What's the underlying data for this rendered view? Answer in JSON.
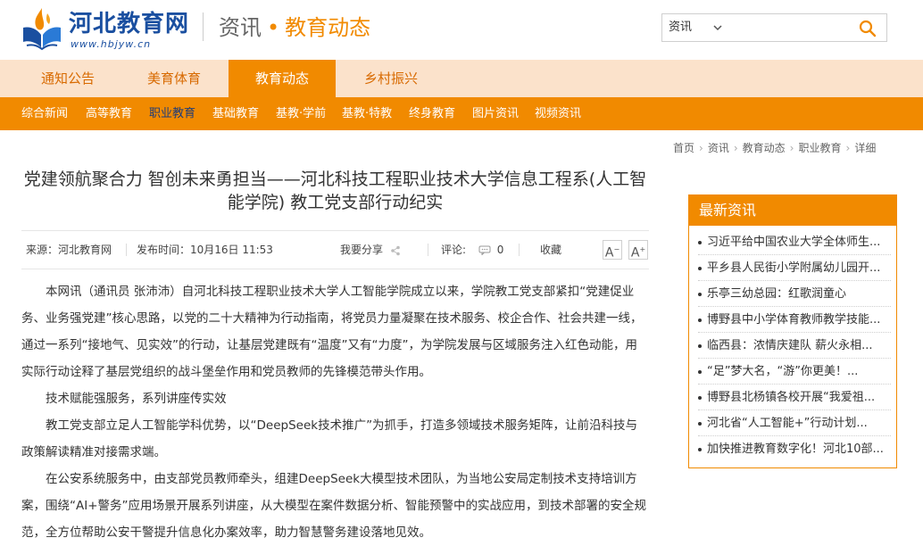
{
  "logo": {
    "title": "河北教育网",
    "url": "www.hbjyw.cn"
  },
  "header": {
    "section": "资讯",
    "dot": "•",
    "subsection": "教育动态"
  },
  "search": {
    "select_value": "资讯",
    "placeholder": ""
  },
  "nav1": [
    "通知公告",
    "美育体育",
    "教育动态",
    "乡村振兴"
  ],
  "nav2": [
    "综合新闻",
    "高等教育",
    "职业教育",
    "基础教育",
    "基教·学前",
    "基教·特教",
    "终身教育",
    "图片资讯",
    "视频资讯"
  ],
  "breadcrumb": [
    "首页",
    "资讯",
    "教育动态",
    "职业教育",
    "详细"
  ],
  "article": {
    "title": "党建领航聚合力 智创未来勇担当——河北科技工程职业技术大学信息工程系(人工智能学院) 教工党支部行动纪实",
    "source": "来源：河北教育网",
    "time": "发布时间：10月16日  11:53",
    "share": "我要分享",
    "comment_label": "评论:",
    "comment_count": "0",
    "favorite": "收藏",
    "font_small": "A",
    "font_large": "A",
    "paragraphs": [
      "本网讯（通讯员 张沛沛）自河北科技工程职业技术大学人工智能学院成立以来，学院教工党支部紧扣“党建促业务、业务强党建”核心思路，以党的二十大精神为行动指南，将党员力量凝聚在技术服务、校企合作、社会共建一线，通过一系列“接地气、见实效”的行动，让基层党建既有“温度”又有“力度”，为学院发展与区域服务注入红色动能，用实际行动诠释了基层党组织的战斗堡垒作用和党员教师的先锋模范带头作用。",
      "技术赋能强服务，系列讲座传实效",
      "教工党支部立足人工智能学科优势，以“DeepSeek技术推广”为抓手，打造多领域技术服务矩阵，让前沿科技与政策解读精准对接需求端。",
      "在公安系统服务中，由支部党员教师牵头，组建DeepSeek大模型技术团队，为当地公安局定制技术支持培训方案，围绕“AI+警务”应用场景开展系列讲座，从大模型在案件数据分析、智能预警中的实战应用，到技术部署的安全规范，全方位帮助公安干警提升信息化办案效率，助力智慧警务建设落地见效。"
    ]
  },
  "sidebar": {
    "title": "最新资讯",
    "items": [
      "习近平给中国农业大学全体师生...",
      "平乡县人民街小学附属幼儿园开...",
      "乐亭三幼总园：红歌润童心",
      "博野县中小学体育教师教学技能...",
      "临西县：浓情庆建队 薪火永相...",
      "“足”梦大名，“游”你更美！...",
      "博野县北杨镇各校开展“我爱祖...",
      "河北省“人工智能+”行动计划...",
      "加快推进教育数字化！河北10部..."
    ]
  },
  "colors": {
    "accent": "#f18a00",
    "nav_bg": "#fbe2cb",
    "brand_blue": "#1a4fa0"
  }
}
